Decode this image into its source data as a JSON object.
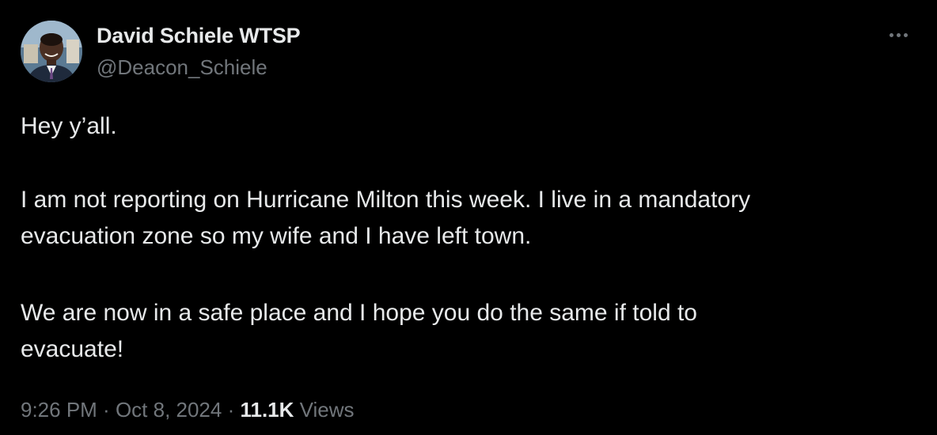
{
  "author": {
    "display_name": "David Schiele WTSP",
    "handle": "@Deacon_Schiele"
  },
  "tweet": {
    "paragraphs": [
      "Hey y’all.",
      "I am not reporting on Hurricane Milton this week. I live in a mandatory\nevacuation zone so my wife and I have left town.",
      "We are now in a safe place and I hope you do the same if told to\nevacuate!"
    ]
  },
  "meta": {
    "time": "9:26 PM",
    "separator": " · ",
    "date": "Oct 8, 2024",
    "views_count": "11.1K",
    "views_label": " Views"
  },
  "icons": {
    "more": "more-horizontal-icon"
  },
  "colors": {
    "background": "#000000",
    "primary_text": "#e7e9ea",
    "secondary_text": "#71767b"
  }
}
